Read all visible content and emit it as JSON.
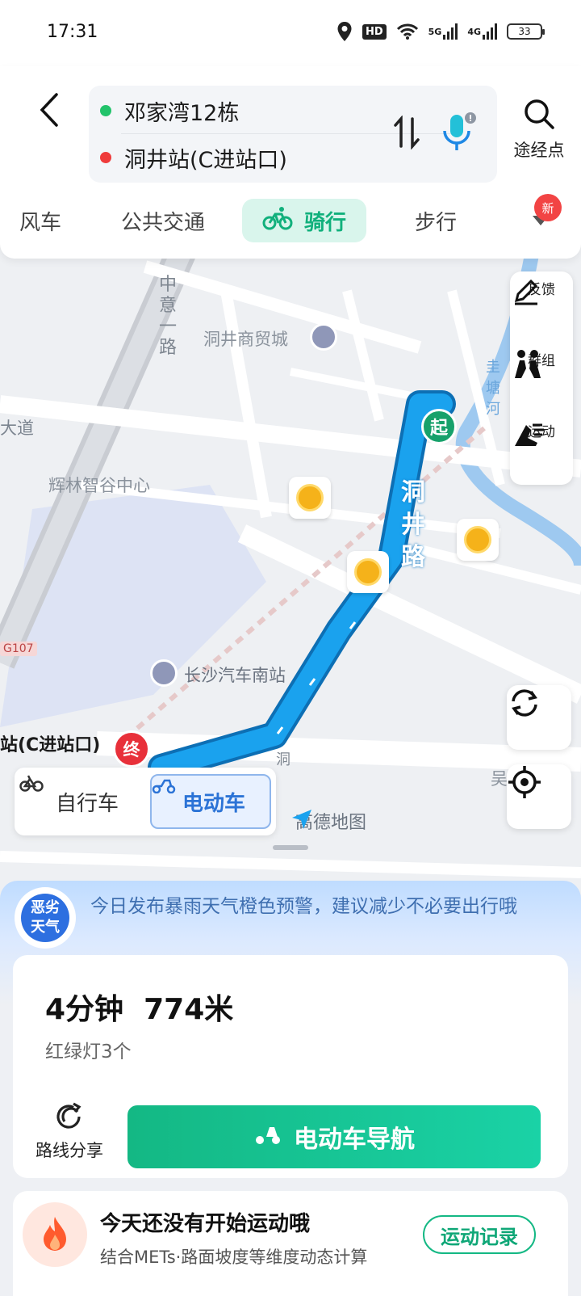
{
  "status": {
    "time": "17:31",
    "hd": "HD",
    "net1": "5G",
    "net2": "4G",
    "battery": "33"
  },
  "route": {
    "from": "邓家湾12栋",
    "to": "洞井站(C进站口)"
  },
  "waypoint_label": "途经点",
  "modes": [
    {
      "label": "顺风车",
      "shown": "风车"
    },
    {
      "label": "公共交通"
    },
    {
      "label": "骑行",
      "active": true
    },
    {
      "label": "步行"
    }
  ],
  "new_badge": "新",
  "map": {
    "pois": {
      "mall": "洞井商贸城",
      "center": "辉林智谷中心",
      "station": "长沙汽车南站",
      "ave": "大道",
      "wu": "吴"
    },
    "roads": {
      "zhongyi": "中意一路",
      "dongjing": "洞井路",
      "dong": "洞",
      "guitang": "圭塘河",
      "g107": "G107"
    },
    "start": "起",
    "end": "终",
    "end_label": "站(C进站口)",
    "brand": "高德地图"
  },
  "tools": [
    {
      "label": "反馈",
      "icon": "edit-icon"
    },
    {
      "label": "群组",
      "icon": "group-icon"
    },
    {
      "label": "运动",
      "icon": "sport-icon"
    }
  ],
  "vehicle": {
    "bike": "自行车",
    "ebike": "电动车"
  },
  "weather": {
    "badge_line1": "恶劣",
    "badge_line2": "天气",
    "text": "今日发布暴雨天气橙色预警，建议减少不必要出行哦"
  },
  "summary": {
    "main": "4分钟  774米",
    "lights": "红绿灯3个",
    "share": "路线分享",
    "nav": "电动车导航"
  },
  "exercise": {
    "title": "今天还没有开始运动哦",
    "sub": "结合METs·路面坡度等维度动态计算",
    "button": "运动记录"
  },
  "colors": {
    "accent": "#14b884",
    "route": "#1a9be6",
    "danger": "#ef3b3b"
  }
}
